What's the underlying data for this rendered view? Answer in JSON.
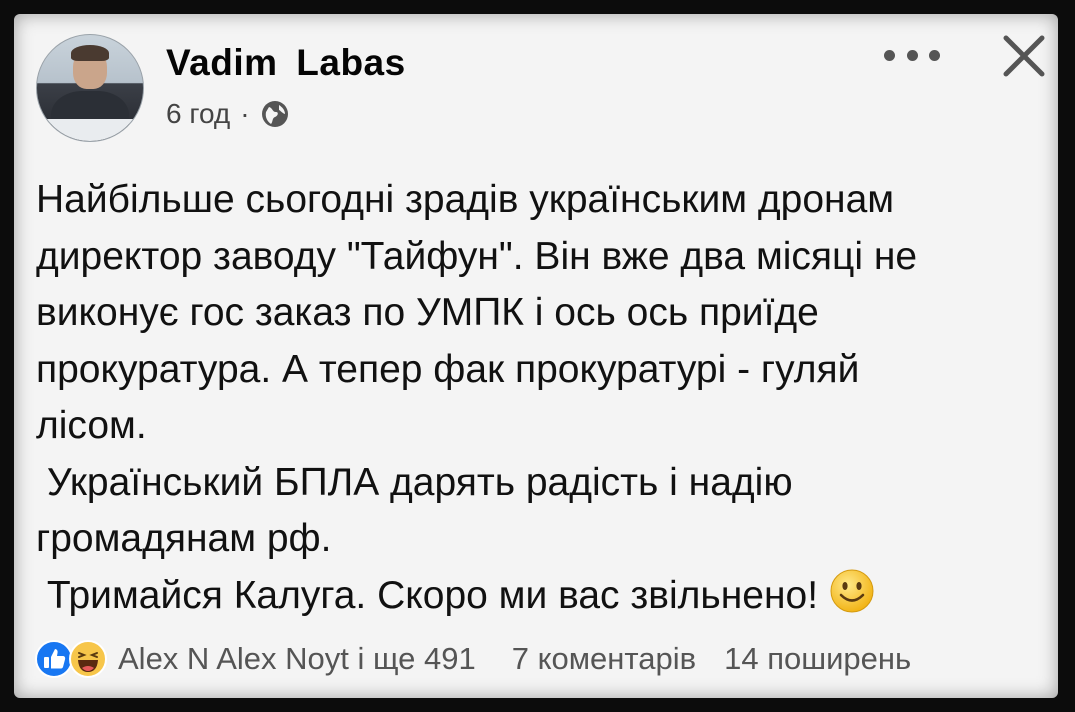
{
  "post": {
    "author": "Vadim  Labas",
    "time": "6 год",
    "separator": "·",
    "privacy_icon": "globe-icon",
    "lines": [
      "Найбільше сьогодні зрадів українським дронам",
      "директор заводу \"Тайфун\". Він вже два місяці не",
      "виконує гос заказ по УМПК і ось ось приїде",
      "прокуратура. А тепер фак прокуратурі - гуляй",
      "лісом.",
      " Український БПЛА дарять радість і надію",
      "громадянам рф.",
      " Тримайся Калуга. Скоро ми вас звільнено! "
    ],
    "emoji_icon": "smiling-face-icon"
  },
  "footer": {
    "reaction_icons": [
      "like-icon",
      "haha-icon"
    ],
    "reactors": "Alex N Alex Noyt і ще 491",
    "comments": "7 коментарів",
    "shares": "14 поширень"
  },
  "colors": {
    "frame": "#0c0c0c",
    "card": "#f4f4f4",
    "like_blue": "#1877f2",
    "haha_yellow": "#f7c64a"
  }
}
